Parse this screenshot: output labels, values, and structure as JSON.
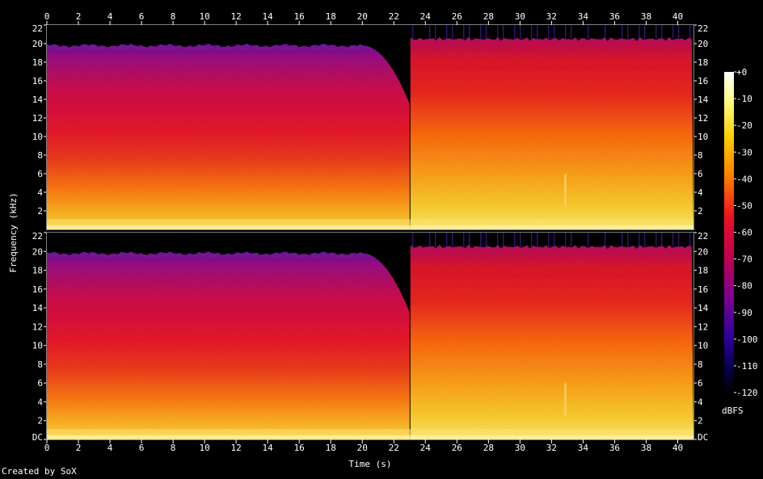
{
  "chart_data": {
    "type": "heatmap",
    "title": "",
    "xlabel": "Time (s)",
    "ylabel": "Frequency (kHz)",
    "xlim": [
      0,
      41
    ],
    "ylim": [
      0,
      22
    ],
    "x_ticks": [
      "0",
      "2",
      "4",
      "6",
      "8",
      "10",
      "12",
      "14",
      "16",
      "18",
      "20",
      "22",
      "24",
      "26",
      "28",
      "30",
      "32",
      "34",
      "36",
      "38",
      "40"
    ],
    "y_ticks_top": [
      "2",
      "4",
      "6",
      "8",
      "10",
      "12",
      "14",
      "16",
      "18",
      "20",
      "22"
    ],
    "y_ticks_bottom": [
      "DC",
      "2",
      "4",
      "6",
      "8",
      "10",
      "12",
      "14",
      "16",
      "18",
      "20",
      "22"
    ],
    "channels": 2,
    "colorbar": {
      "label": "dBFS",
      "ticks": [
        "+0",
        "-10",
        "-20",
        "-30",
        "-40",
        "-50",
        "-60",
        "-70",
        "-80",
        "-90",
        "-100",
        "-110",
        "-120"
      ],
      "range": [
        -120,
        0
      ]
    },
    "segments": [
      {
        "t_start": 0,
        "t_end": 20,
        "cutoff_khz": 19.8
      },
      {
        "t_start": 20,
        "t_end": 23,
        "cutoff_khz_from": 19.8,
        "cutoff_khz_to": 13.5
      },
      {
        "t_start": 23,
        "t_end": 41,
        "cutoff_khz": 20.5
      }
    ],
    "footer": "Created by SoX"
  }
}
